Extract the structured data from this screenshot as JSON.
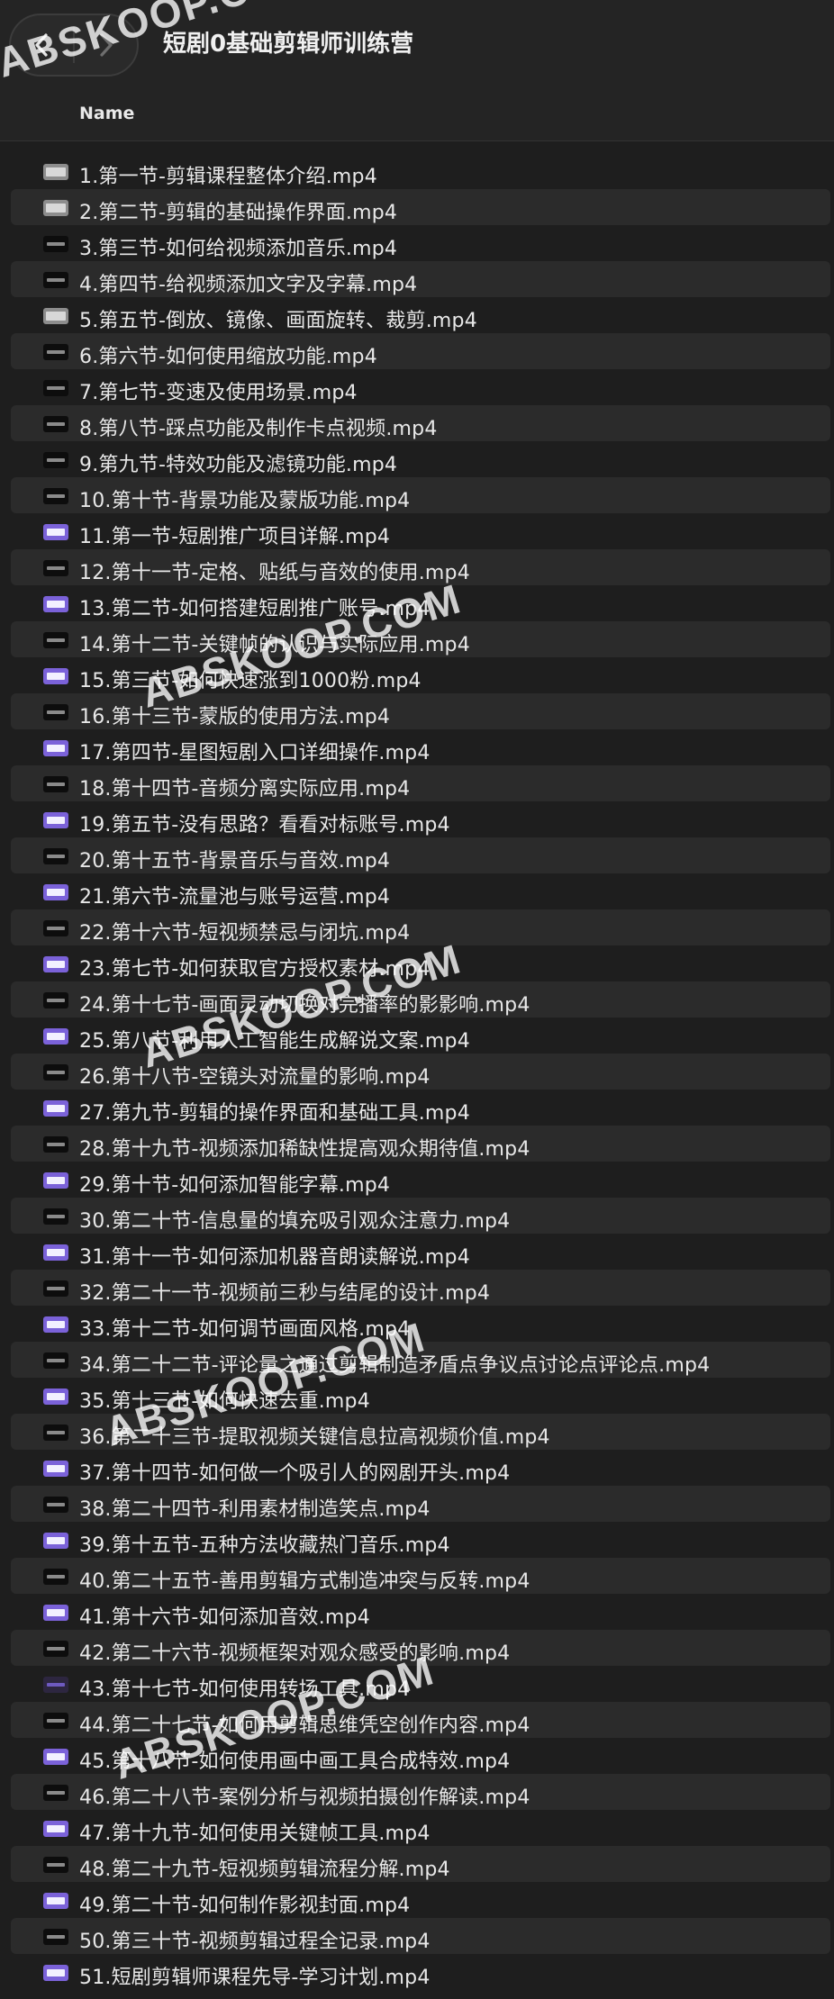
{
  "window": {
    "title": "短剧0基础剪辑师训练营"
  },
  "toolbar": {
    "back_icon": "chevron-left-icon",
    "forward_icon": "chevron-right-icon"
  },
  "columns": {
    "name": "Name"
  },
  "files": [
    {
      "name": "1.第一节-剪辑课程整体介绍.mp4",
      "thumb": "gray"
    },
    {
      "name": "2.第二节-剪辑的基础操作界面.mp4",
      "thumb": "gray"
    },
    {
      "name": "3.第三节-如何给视频添加音乐.mp4",
      "thumb": "dark"
    },
    {
      "name": "4.第四节-给视频添加文字及字幕.mp4",
      "thumb": "dark"
    },
    {
      "name": "5.第五节-倒放、镜像、画面旋转、裁剪.mp4",
      "thumb": "gray"
    },
    {
      "name": "6.第六节-如何使用缩放功能.mp4",
      "thumb": "dark"
    },
    {
      "name": "7.第七节-变速及使用场景.mp4",
      "thumb": "dark"
    },
    {
      "name": "8.第八节-踩点功能及制作卡点视频.mp4",
      "thumb": "dark"
    },
    {
      "name": "9.第九节-特效功能及滤镜功能.mp4",
      "thumb": "dark"
    },
    {
      "name": "10.第十节-背景功能及蒙版功能.mp4",
      "thumb": "dark"
    },
    {
      "name": "11.第一节-短剧推广项目详解.mp4",
      "thumb": "purple"
    },
    {
      "name": "12.第十一节-定格、贴纸与音效的使用.mp4",
      "thumb": "dark"
    },
    {
      "name": "13.第二节-如何搭建短剧推广账号.mp4",
      "thumb": "purple"
    },
    {
      "name": "14.第十二节-关键帧的认识与实际应用.mp4",
      "thumb": "dark"
    },
    {
      "name": "15.第三节-如何快速涨到1000粉.mp4",
      "thumb": "purple"
    },
    {
      "name": "16.第十三节-蒙版的使用方法.mp4",
      "thumb": "dark"
    },
    {
      "name": "17.第四节-星图短剧入口详细操作.mp4",
      "thumb": "purple"
    },
    {
      "name": "18.第十四节-音频分离实际应用.mp4",
      "thumb": "dark"
    },
    {
      "name": "19.第五节-没有思路？看看对标账号.mp4",
      "thumb": "purple"
    },
    {
      "name": "20.第十五节-背景音乐与音效.mp4",
      "thumb": "dark"
    },
    {
      "name": "21.第六节-流量池与账号运营.mp4",
      "thumb": "purple"
    },
    {
      "name": "22.第十六节-短视频禁忌与闭坑.mp4",
      "thumb": "dark"
    },
    {
      "name": "23.第七节-如何获取官方授权素材.mp4",
      "thumb": "purple"
    },
    {
      "name": "24.第十七节-画面灵动切换对完播率的影影响.mp4",
      "thumb": "dark"
    },
    {
      "name": "25.第八节-利用人工智能生成解说文案.mp4",
      "thumb": "purple"
    },
    {
      "name": "26.第十八节-空镜头对流量的影响.mp4",
      "thumb": "dark"
    },
    {
      "name": "27.第九节-剪辑的操作界面和基础工具.mp4",
      "thumb": "purple"
    },
    {
      "name": "28.第十九节-视频添加稀缺性提高观众期待值.mp4",
      "thumb": "dark"
    },
    {
      "name": "29.第十节-如何添加智能字幕.mp4",
      "thumb": "purple"
    },
    {
      "name": "30.第二十节-信息量的填充吸引观众注意力.mp4",
      "thumb": "dark"
    },
    {
      "name": "31.第十一节-如何添加机器音朗读解说.mp4",
      "thumb": "purple"
    },
    {
      "name": "32.第二十一节-视频前三秒与结尾的设计.mp4",
      "thumb": "dark"
    },
    {
      "name": "33.第十二节-如何调节画面风格.mp4",
      "thumb": "purple"
    },
    {
      "name": "34.第二十二节-评论量之通过剪辑制造矛盾点争议点讨论点评论点.mp4",
      "thumb": "dark"
    },
    {
      "name": "35.第十三节-如何快速去重.mp4",
      "thumb": "purple"
    },
    {
      "name": "36.第二十三节-提取视频关键信息拉高视频价值.mp4",
      "thumb": "dark"
    },
    {
      "name": "37.第十四节-如何做一个吸引人的网剧开头.mp4",
      "thumb": "purple"
    },
    {
      "name": "38.第二十四节-利用素材制造笑点.mp4",
      "thumb": "dark"
    },
    {
      "name": "39.第十五节-五种方法收藏热门音乐.mp4",
      "thumb": "purple"
    },
    {
      "name": "40.第二十五节-善用剪辑方式制造冲突与反转.mp4",
      "thumb": "dark"
    },
    {
      "name": "41.第十六节-如何添加音效.mp4",
      "thumb": "purple"
    },
    {
      "name": "42.第二十六节-视频框架对观众感受的影响.mp4",
      "thumb": "dark"
    },
    {
      "name": "43.第十七节-如何使用转场工具.mp4",
      "thumb": "darkpurple"
    },
    {
      "name": "44.第二十七节-如何用剪辑思维凭空创作内容.mp4",
      "thumb": "dark"
    },
    {
      "name": "45.第十八节-如何使用画中画工具合成特效.mp4",
      "thumb": "purple"
    },
    {
      "name": "46.第二十八节-案例分析与视频拍摄创作解读.mp4",
      "thumb": "dark"
    },
    {
      "name": "47.第十九节-如何使用关键帧工具.mp4",
      "thumb": "purple"
    },
    {
      "name": "48.第二十九节-短视频剪辑流程分解.mp4",
      "thumb": "dark"
    },
    {
      "name": "49.第二十节-如何制作影视封面.mp4",
      "thumb": "purple"
    },
    {
      "name": "50.第三十节-视频剪辑过程全记录.mp4",
      "thumb": "dark"
    },
    {
      "name": "51.短剧剪辑师课程先导-学习计划.mp4",
      "thumb": "purple"
    }
  ],
  "watermarks": [
    "ABSKOOP.COM",
    "ABSKOOP.COM",
    "ABSKOOP.COM",
    "ABSKOOP.COM",
    "ABSKOOP.COM"
  ]
}
